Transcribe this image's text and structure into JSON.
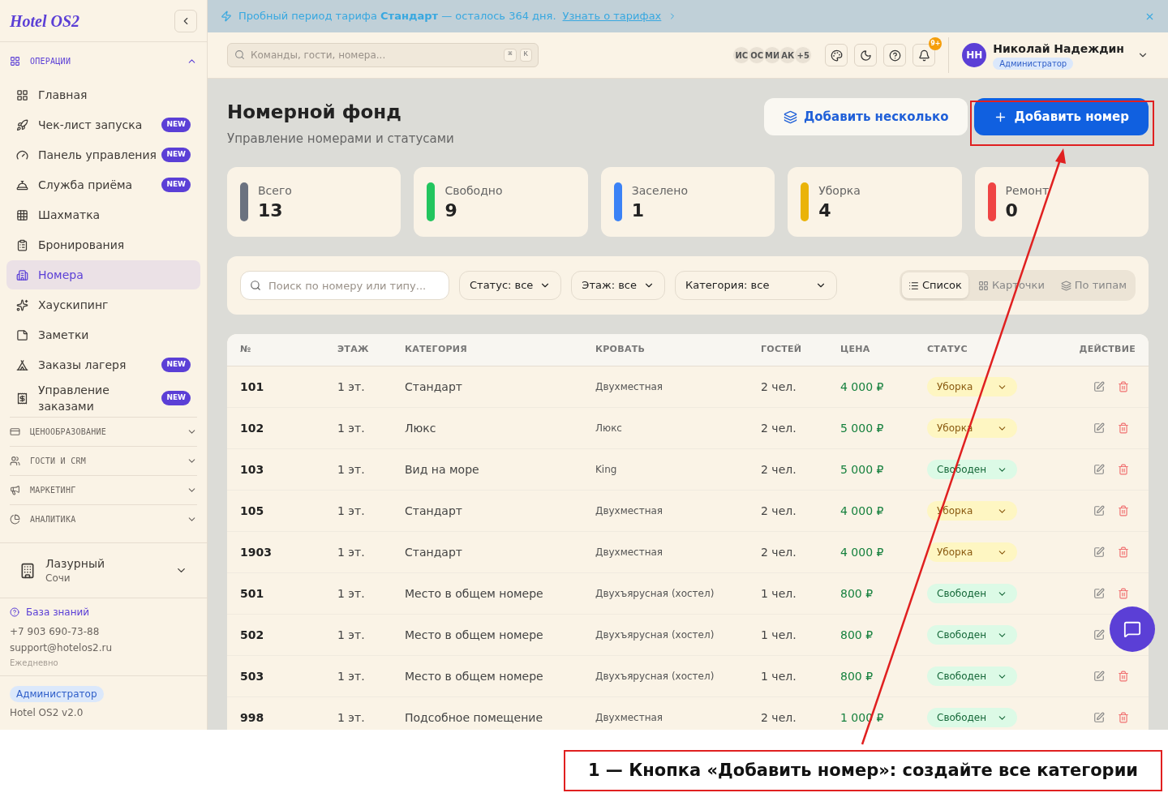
{
  "sidebar": {
    "logo": "Hotel OS2",
    "open_section": {
      "title": "ОПЕРАЦИИ",
      "expanded": true
    },
    "items": [
      {
        "label": "Главная",
        "selected": false
      },
      {
        "label": "Чек-лист запуска",
        "badge": "NEW",
        "selected": false
      },
      {
        "label": "Панель управления",
        "badge": "NEW",
        "selected": false
      },
      {
        "label": "Служба приёма",
        "badge": "NEW",
        "selected": false
      },
      {
        "label": "Шахматка",
        "selected": false
      },
      {
        "label": "Бронирования",
        "selected": false
      },
      {
        "label": "Номера",
        "selected": true
      },
      {
        "label": "Хаускипинг",
        "selected": false
      },
      {
        "label": "Заметки",
        "selected": false
      },
      {
        "label": "Заказы лагеря",
        "badge": "NEW",
        "selected": false
      },
      {
        "label": "Управление заказами",
        "badge": "NEW",
        "selected": false
      }
    ],
    "sections": [
      {
        "title": "ЦЕНООБРАЗОВАНИЕ",
        "expanded": false
      },
      {
        "title": "ГОСТИ И CRM",
        "expanded": false
      },
      {
        "title": "МАРКЕТИНГ",
        "expanded": false
      },
      {
        "title": "АНАЛИТИКА",
        "expanded": false
      }
    ],
    "property": {
      "name": "Лазурный",
      "city": "Сочи"
    },
    "support": {
      "link": "База знаний",
      "phone": "+7 903 690-73-88",
      "email": "support@hotelos2.ru",
      "hours": "Ежедневно"
    },
    "role": "Администратор",
    "version": "Hotel OS2 v2.0"
  },
  "banner": {
    "text": "Пробный период тарифа **Стандарт** — осталось 364 дня.",
    "link": "Узнать о тарифах"
  },
  "topbar": {
    "search": {
      "placeholder": "Команды, гости, номера..."
    },
    "shortcut": [
      "⌘",
      "K"
    ],
    "avatars": [
      "ИС",
      "ОС",
      "МИ",
      "АК",
      "+5"
    ],
    "notifications_badge": "9+",
    "user": {
      "initials": "НН",
      "name": "Николай Надеждин",
      "role": "Администратор"
    }
  },
  "page": {
    "title": "Номерной фонд",
    "subtitle": "Управление номерами и статусами",
    "buttons": [
      "Добавить несколько",
      "Добавить номер"
    ]
  },
  "stats": [
    {
      "label": "Всего",
      "value": "13",
      "color": "#6b7280"
    },
    {
      "label": "Свободно",
      "value": "9",
      "color": "#22c55e"
    },
    {
      "label": "Заселено",
      "value": "1",
      "color": "#3b82f6"
    },
    {
      "label": "Уборка",
      "value": "4",
      "color": "#eab308"
    },
    {
      "label": "Ремонт",
      "value": "0",
      "color": "#ef4444"
    }
  ],
  "filters": {
    "search": {
      "placeholder": "Поиск по номеру или типу..."
    },
    "selects": [
      "Статус: все",
      "Этаж: все",
      "Категория: все"
    ],
    "views": [
      {
        "label": "Список",
        "selected": true
      },
      {
        "label": "Карточки",
        "selected": false
      },
      {
        "label": "По типам",
        "selected": false
      }
    ]
  },
  "table": {
    "columns": [
      "№",
      "ЭТАЖ",
      "КАТЕГОРИЯ",
      "КРОВАТЬ",
      "ГОСТЕЙ",
      "ЦЕНА",
      "СТАТУС",
      "ДЕЙСТВИЕ"
    ],
    "rows": [
      {
        "number": "101",
        "floor": "1 эт.",
        "category": "Стандарт",
        "bed": "Двухместная",
        "guests": "2 чел.",
        "price": "4 000 ₽",
        "status": "Уборка",
        "kind": "cleaning"
      },
      {
        "number": "102",
        "floor": "1 эт.",
        "category": "Люкс",
        "bed": "Люкс",
        "guests": "2 чел.",
        "price": "5 000 ₽",
        "status": "Уборка",
        "kind": "cleaning"
      },
      {
        "number": "103",
        "floor": "1 эт.",
        "category": "Вид на море",
        "bed": "King",
        "guests": "2 чел.",
        "price": "5 000 ₽",
        "status": "Свободен",
        "kind": "free"
      },
      {
        "number": "105",
        "floor": "1 эт.",
        "category": "Стандарт",
        "bed": "Двухместная",
        "guests": "2 чел.",
        "price": "4 000 ₽",
        "status": "Уборка",
        "kind": "cleaning"
      },
      {
        "number": "1903",
        "floor": "1 эт.",
        "category": "Стандарт",
        "bed": "Двухместная",
        "guests": "2 чел.",
        "price": "4 000 ₽",
        "status": "Уборка",
        "kind": "cleaning"
      },
      {
        "number": "501",
        "floor": "1 эт.",
        "category": "Место в общем номере",
        "bed": "Двухъярусная (хостел)",
        "guests": "1 чел.",
        "price": "800 ₽",
        "status": "Свободен",
        "kind": "free"
      },
      {
        "number": "502",
        "floor": "1 эт.",
        "category": "Место в общем номере",
        "bed": "Двухъярусная (хостел)",
        "guests": "1 чел.",
        "price": "800 ₽",
        "status": "Свободен",
        "kind": "free"
      },
      {
        "number": "503",
        "floor": "1 эт.",
        "category": "Место в общем номере",
        "bed": "Двухъярусная (хостел)",
        "guests": "1 чел.",
        "price": "800 ₽",
        "status": "Свободен",
        "kind": "free"
      },
      {
        "number": "998",
        "floor": "1 эт.",
        "category": "Подсобное помещение",
        "bed": "Двухместная",
        "guests": "2 чел.",
        "price": "1 000 ₽",
        "status": "Свободен",
        "kind": "free"
      }
    ]
  },
  "annotation": {
    "caption": "1 — Кнопка «Добавить номер»: создайте все категории"
  }
}
